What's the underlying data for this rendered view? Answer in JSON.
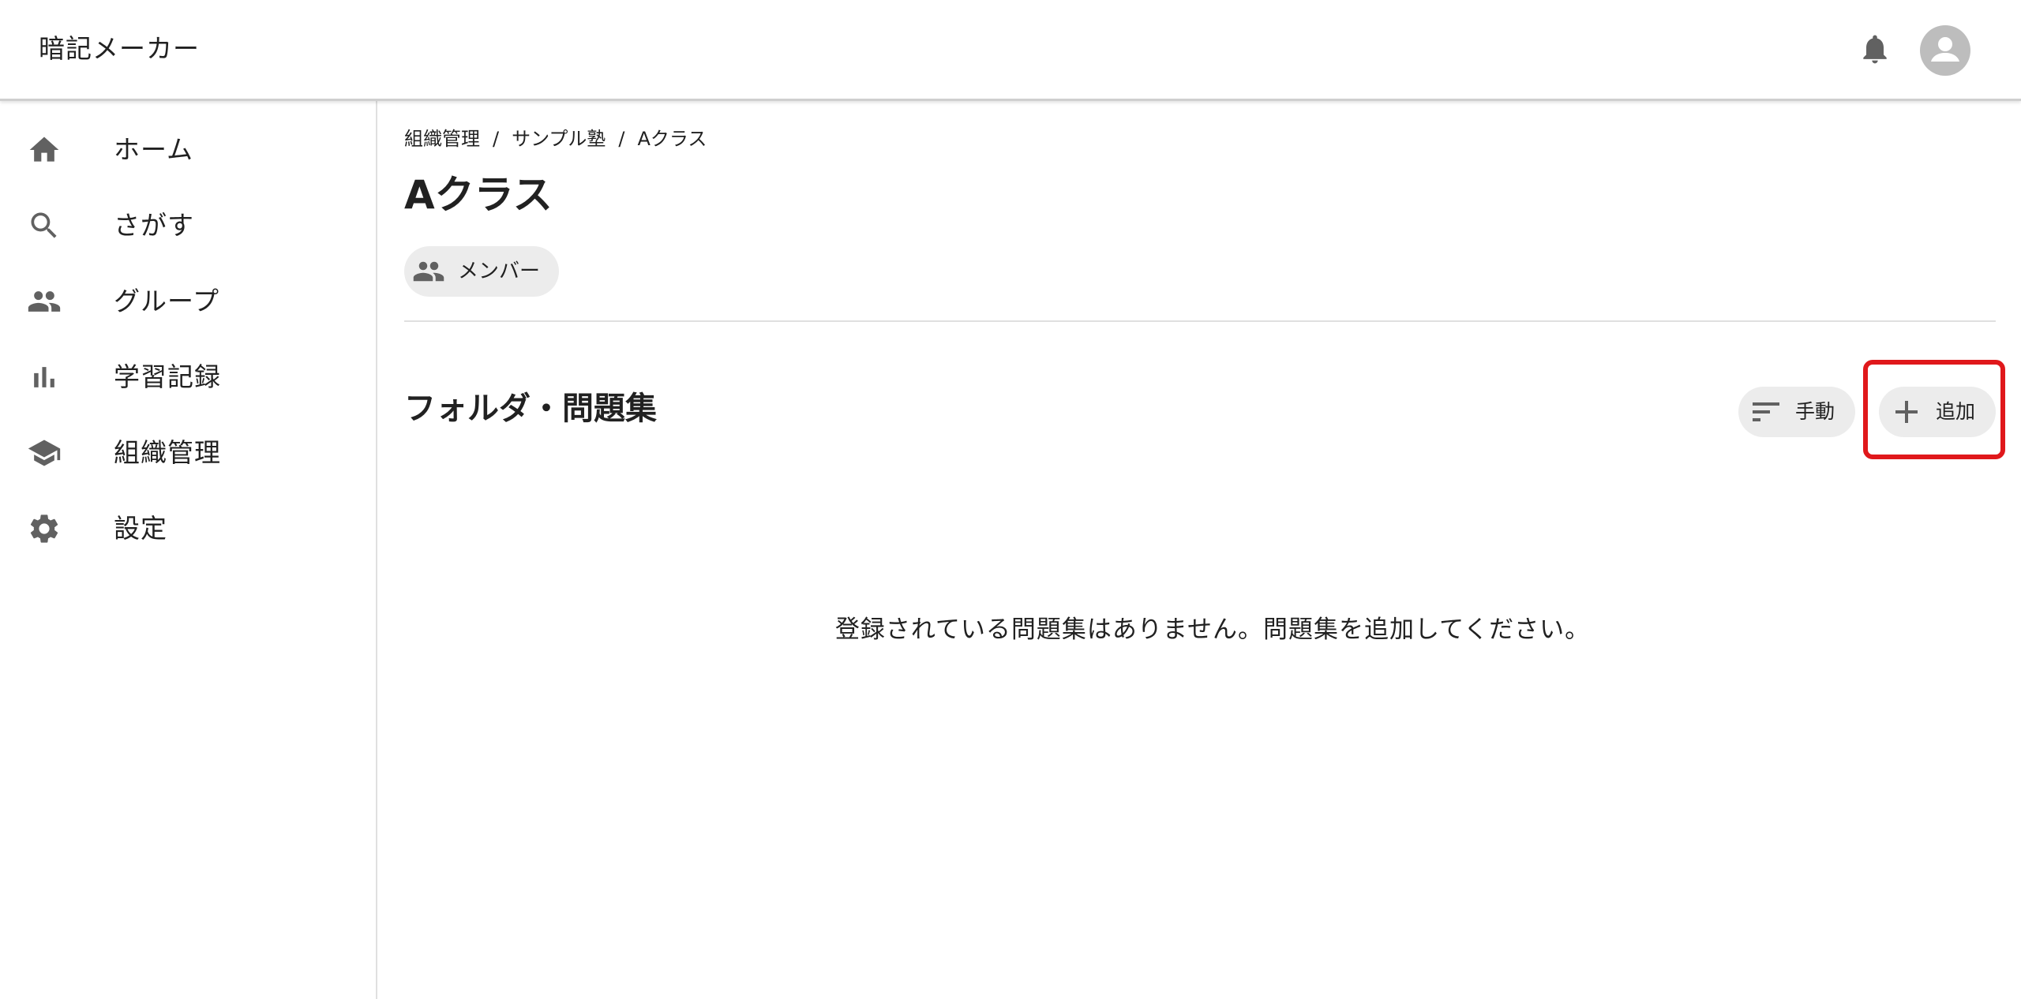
{
  "header": {
    "app_title": "暗記メーカー",
    "notification_icon": "bell-icon",
    "account_icon": "account-circle-icon"
  },
  "sidebar": {
    "items": [
      {
        "label": "ホーム",
        "icon": "home-icon"
      },
      {
        "label": "さがす",
        "icon": "search-icon"
      },
      {
        "label": "グループ",
        "icon": "people-icon"
      },
      {
        "label": "学習記録",
        "icon": "bar-chart-icon"
      },
      {
        "label": "組織管理",
        "icon": "school-icon"
      },
      {
        "label": "設定",
        "icon": "gear-icon"
      }
    ]
  },
  "breadcrumb": {
    "items": [
      "組織管理",
      "サンプル塾",
      "Aクラス"
    ],
    "separator": "/"
  },
  "page": {
    "title": "Aクラス",
    "member_button": "メンバー"
  },
  "section": {
    "title": "フォルダ・問題集",
    "sort_label": "手動",
    "add_label": "追加",
    "empty_message": "登録されている問題集はありません。問題集を追加してください。"
  },
  "colors": {
    "icon": "#616161",
    "text": "#212121",
    "chip_bg": "#ececec",
    "highlight": "#e0181b",
    "avatar_bg": "#bdbdbd"
  }
}
